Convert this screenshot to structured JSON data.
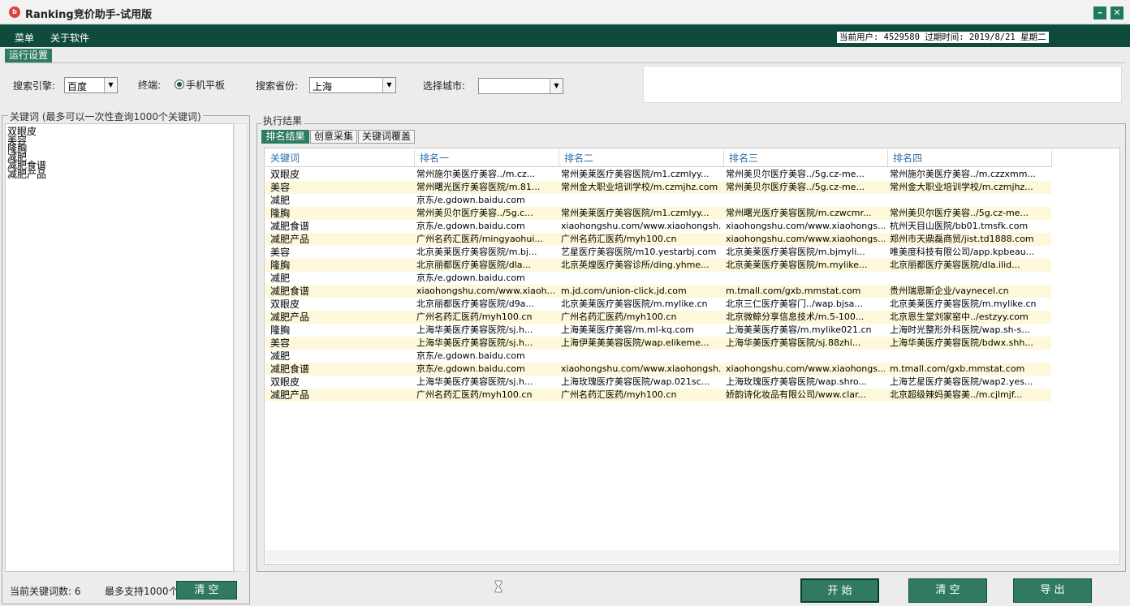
{
  "window": {
    "title": "Ranking竞价助手-试用版",
    "logo_text": "b"
  },
  "window_controls": {
    "minimize": "–",
    "close": "✕"
  },
  "menubar": {
    "items": [
      {
        "label": "菜单"
      },
      {
        "label": "关于软件"
      }
    ],
    "user_info": "当前用户: 4529580 过期时间: 2019/8/21 星期二"
  },
  "settings": {
    "tab_label": "运行设置",
    "engine_label": "搜索引擎:",
    "engine_value": "百度",
    "terminal_label": "终端:",
    "terminal_option": "手机平板",
    "province_label": "搜索省份:",
    "province_value": "上海",
    "city_label": "选择城市:",
    "city_value": ""
  },
  "keywords_panel": {
    "title": "关键词 (最多可以一次性查询1000个关键词)",
    "keywords": [
      "双眼皮",
      "美容",
      "隆胸",
      "减肥",
      "减肥食谱",
      "减肥产品"
    ],
    "count_label": "当前关键词数: 6",
    "max_label": "最多支持1000个",
    "clear_label": "清 空"
  },
  "results": {
    "group_title": "执行结果",
    "tabs": [
      {
        "label": "排名结果"
      },
      {
        "label": "创意采集"
      },
      {
        "label": "关键词覆盖"
      }
    ],
    "columns": [
      "关键词",
      "排名一",
      "排名二",
      "排名三",
      "排名四"
    ],
    "rows": [
      [
        "双眼皮",
        "常州施尔美医疗美容../m.cz...",
        "常州美莱医疗美容医院/m1.czmlyy...",
        "常州美贝尔医疗美容../5g.cz-me...",
        "常州施尔美医疗美容../m.czzxmm..."
      ],
      [
        "美容",
        "常州曙光医疗美容医院/m.81...",
        "常州金大职业培训学校/m.czmjhz.com",
        "常州美贝尔医疗美容../5g.cz-me...",
        "常州金大职业培训学校/m.czmjhz..."
      ],
      [
        "减肥",
        "京东/e.gdown.baidu.com",
        "",
        "",
        ""
      ],
      [
        "隆胸",
        "常州美贝尔医疗美容../5g.c...",
        "常州美莱医疗美容医院/m1.czmlyy...",
        "常州曙光医疗美容医院/m.czwcmr...",
        "常州美贝尔医疗美容../5g.cz-me..."
      ],
      [
        "减肥食谱",
        "京东/e.gdown.baidu.com",
        "xiaohongshu.com/www.xiaohongsh...",
        "xiaohongshu.com/www.xiaohongs...",
        "杭州天目山医院/bb01.tmsfk.com"
      ],
      [
        "减肥产品",
        "广州名药汇医药/mingyaohui...",
        "广州名药汇医药/myh100.cn",
        "xiaohongshu.com/www.xiaohongs...",
        "郑州市天鼎磊商贸/jist.td1888.com"
      ],
      [
        "美容",
        "北京美莱医疗美容医院/m.bj...",
        "艺星医疗美容医院/m10.yestarbj.com",
        "北京美莱医疗美容医院/m.bjmyli...",
        "唯美度科技有限公司/app.kpbeau..."
      ],
      [
        "隆胸",
        "北京丽都医疗美容医院/dla...",
        "北京英煌医疗美容诊所/ding.yhme...",
        "北京美莱医疗美容医院/m.mylike...",
        "北京丽都医疗美容医院/dla.ilid..."
      ],
      [
        "减肥",
        "京东/e.gdown.baidu.com",
        "",
        "",
        ""
      ],
      [
        "减肥食谱",
        "xiaohongshu.com/www.xiaoh...",
        "m.jd.com/union-click.jd.com",
        "m.tmall.com/gxb.mmstat.com",
        "贵州瑞恩斯企业/vaynecel.cn"
      ],
      [
        "双眼皮",
        "北京丽都医疗美容医院/d9a...",
        "北京美莱医疗美容医院/m.mylike.cn",
        "北京三仁医疗美容门../wap.bjsa...",
        "北京美莱医疗美容医院/m.mylike.cn"
      ],
      [
        "减肥产品",
        "广州名药汇医药/myh100.cn",
        "广州名药汇医药/myh100.cn",
        "北京微鲸分享信息技术/m.5-100...",
        "北京恩生堂刘家窑中../estzyy.com"
      ],
      [
        "隆胸",
        "上海华美医疗美容医院/sj.h...",
        "上海美莱医疗美容/m.ml-kq.com",
        "上海美莱医疗美容/m.mylike021.cn",
        "上海时光整形外科医院/wap.sh-s..."
      ],
      [
        "美容",
        "上海华美医疗美容医院/sj.h...",
        "上海伊莱美美容医院/wap.elikeme...",
        "上海华美医疗美容医院/sj.88zhi...",
        "上海华美医疗美容医院/bdwx.shh..."
      ],
      [
        "减肥",
        "京东/e.gdown.baidu.com",
        "",
        "",
        ""
      ],
      [
        "减肥食谱",
        "京东/e.gdown.baidu.com",
        "xiaohongshu.com/www.xiaohongsh...",
        "xiaohongshu.com/www.xiaohongs...",
        "m.tmall.com/gxb.mmstat.com"
      ],
      [
        "双眼皮",
        "上海华美医疗美容医院/sj.h...",
        "上海玫瑰医疗美容医院/wap.021sc...",
        "上海玫瑰医疗美容医院/wap.shro...",
        "上海艺星医疗美容医院/wap2.yes..."
      ],
      [
        "减肥产品",
        "广州名药汇医药/myh100.cn",
        "广州名药汇医药/myh100.cn",
        "娇韵诗化妆品有限公司/www.clar...",
        "北京超级辣妈美容美../m.cjlmjf..."
      ]
    ]
  },
  "actions": {
    "start": "开 始",
    "clear": "清 空",
    "export": "导 出"
  },
  "icons": {
    "dropdown": "dropdown-arrow-icon",
    "radio": "radio-selected-icon",
    "busy": "busy-cursor-icon"
  },
  "colors": {
    "menubar": "#0f4b3c",
    "button": "#2f7a61",
    "active_tab": "#2c7b62",
    "header_text": "#2e6fa8",
    "row_alt": "#fdf8da"
  }
}
